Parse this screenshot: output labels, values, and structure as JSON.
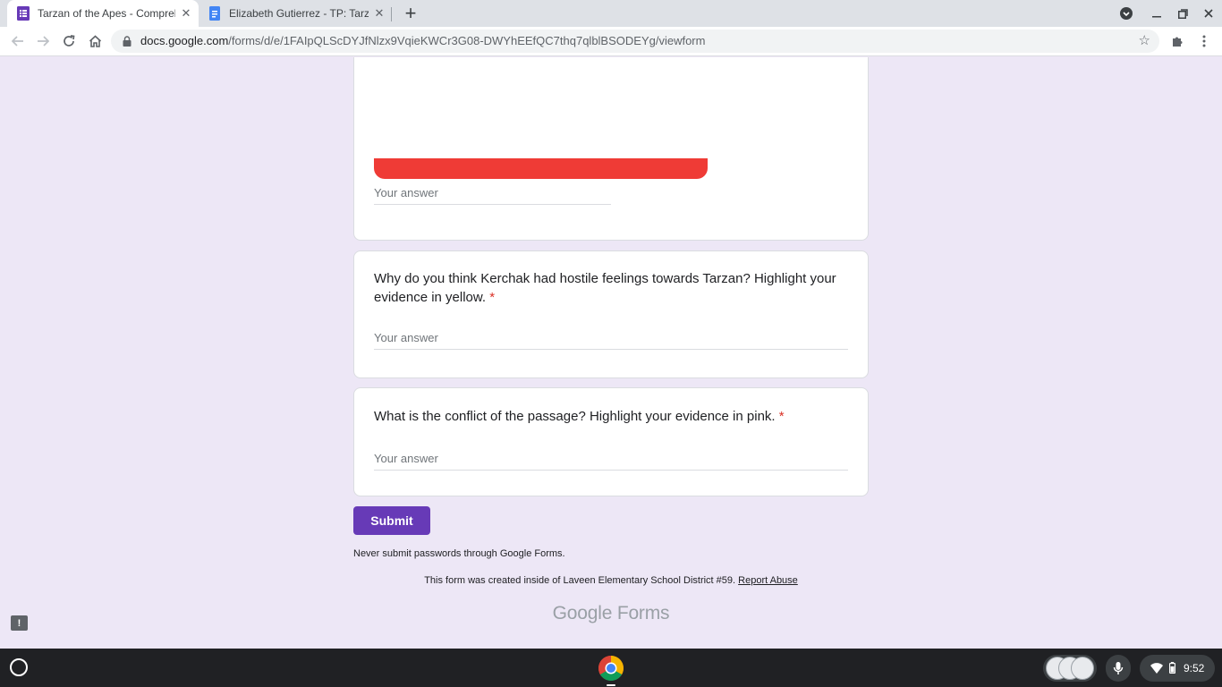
{
  "tabs": [
    {
      "title": "Tarzan of the Apes - Comprehen",
      "icon": "google-forms-icon",
      "active": true
    },
    {
      "title": "Elizabeth Gutierrez - TP: Tarzan c",
      "icon": "google-docs-icon",
      "active": false
    }
  ],
  "address_bar": {
    "host": "docs.google.com",
    "path": "/forms/d/e/1FAIpQLScDYJfNlzx9VqieKWCr3G08-DWYhEEfQC7thq7qlblBSODEYg/viewform"
  },
  "form": {
    "answer_placeholder": "Your answer",
    "questions": [
      {
        "text": "Why do you think Kerchak had hostile feelings towards Tarzan? Highlight your evidence in yellow.",
        "required_mark": "*"
      },
      {
        "text": "What is the conflict of the passage? Highlight your evidence in pink.",
        "required_mark": "*"
      }
    ],
    "submit_label": "Submit",
    "password_warning": "Never submit passwords through Google Forms.",
    "footer_text": "This form was created inside of Laveen Elementary School District #59.",
    "report_link": "Report Abuse",
    "brand_google": "Google",
    "brand_forms": "Forms",
    "feedback_glyph": "!"
  },
  "system_tray": {
    "time": "9:52"
  },
  "colors": {
    "form_background": "#ede7f6",
    "accent": "#673ab7",
    "required": "#d93025",
    "banner": "#ef3b36"
  }
}
